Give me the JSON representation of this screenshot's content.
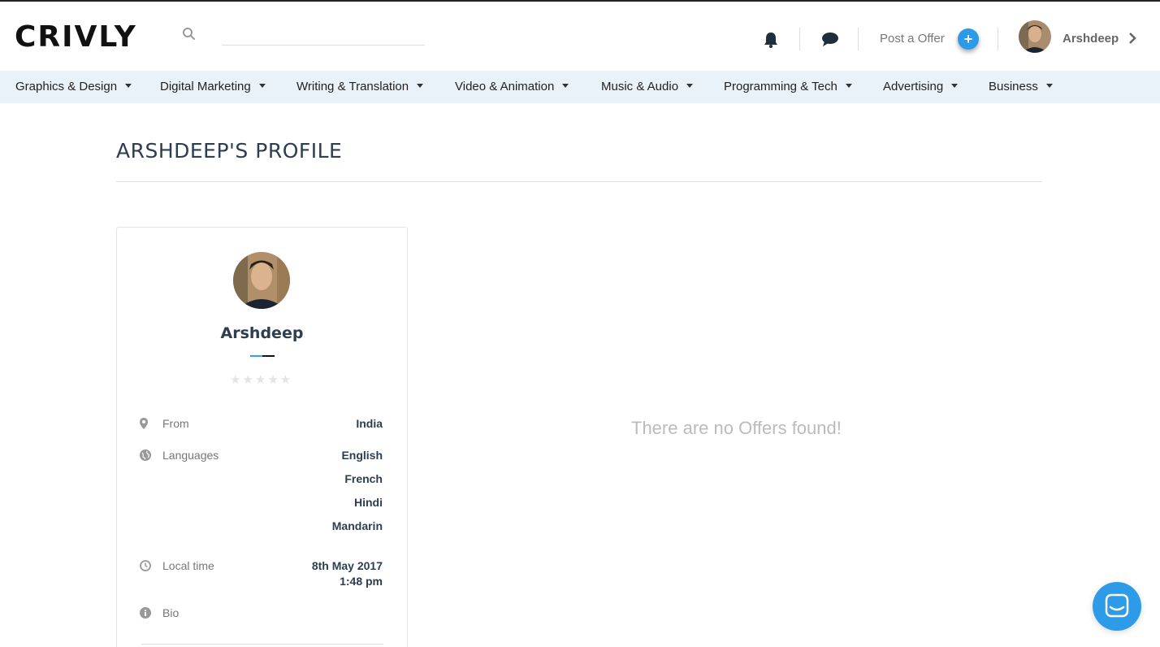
{
  "header": {
    "logo": "CRIVLY",
    "search_placeholder": "",
    "post_offer_label": "Post a Offer",
    "plus_label": "+",
    "user_name": "Arshdeep"
  },
  "categories": [
    "Graphics & Design",
    "Digital Marketing",
    "Writing & Translation",
    "Video & Animation",
    "Music & Audio",
    "Programming & Tech",
    "Advertising",
    "Business"
  ],
  "page": {
    "title": "ARSHDEEP'S PROFILE",
    "empty_message": "There are no Offers found!"
  },
  "profile": {
    "name": "Arshdeep",
    "rating": 0,
    "rating_max": 5,
    "stars": "★★★★★",
    "from_label": "From",
    "from_value": "India",
    "languages_label": "Languages",
    "languages": [
      "English",
      "French",
      "Hindi",
      "Mandarin"
    ],
    "local_time_label": "Local time",
    "local_date": "8th May 2017",
    "local_time": "1:48 pm",
    "bio_label": "Bio"
  },
  "colors": {
    "accent": "#2c9ae8",
    "category_bar": "#eaf2f9",
    "text_dark": "#2c3e50",
    "muted": "#bbbbbb"
  },
  "icons": [
    "search-icon",
    "bell-icon",
    "chat-bubble-icon",
    "plus-icon",
    "chevron-right-icon",
    "map-pin-icon",
    "globe-icon",
    "clock-icon",
    "info-icon",
    "chat-launcher-icon"
  ]
}
